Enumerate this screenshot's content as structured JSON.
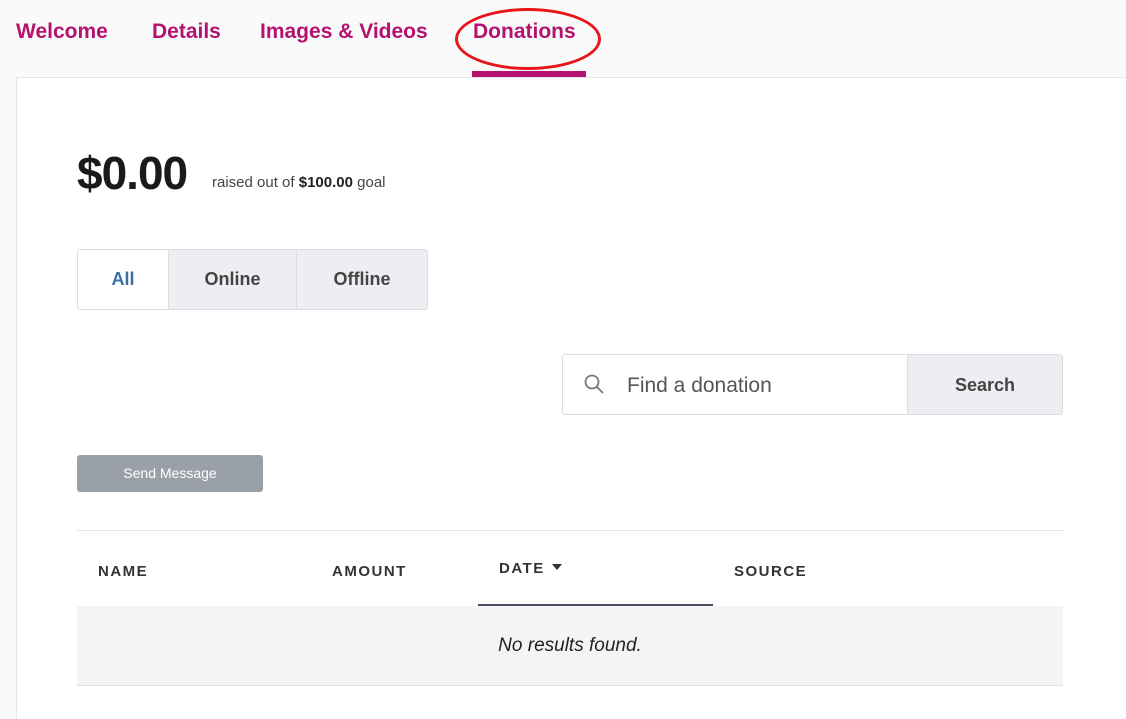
{
  "tabs": [
    {
      "label": "Welcome",
      "active": false
    },
    {
      "label": "Details",
      "active": false
    },
    {
      "label": "Images & Videos",
      "active": false
    },
    {
      "label": "Donations",
      "active": true
    }
  ],
  "summary": {
    "raised": "$0.00",
    "raised_prefix": "raised out of",
    "goal": "$100.00",
    "raised_suffix": "goal"
  },
  "filters": [
    {
      "label": "All",
      "active": true
    },
    {
      "label": "Online",
      "active": false
    },
    {
      "label": "Offline",
      "active": false
    }
  ],
  "search": {
    "placeholder": "Find a donation",
    "button_label": "Search"
  },
  "actions": {
    "send_message_label": "Send Message"
  },
  "table": {
    "columns": [
      "NAME",
      "AMOUNT",
      "DATE",
      "SOURCE"
    ],
    "sorted_column": "DATE",
    "empty_message": "No results found."
  },
  "colors": {
    "accent": "#b5126f",
    "annotation_circle": "#e8161b",
    "active_filter_text": "#3c6ea4"
  }
}
